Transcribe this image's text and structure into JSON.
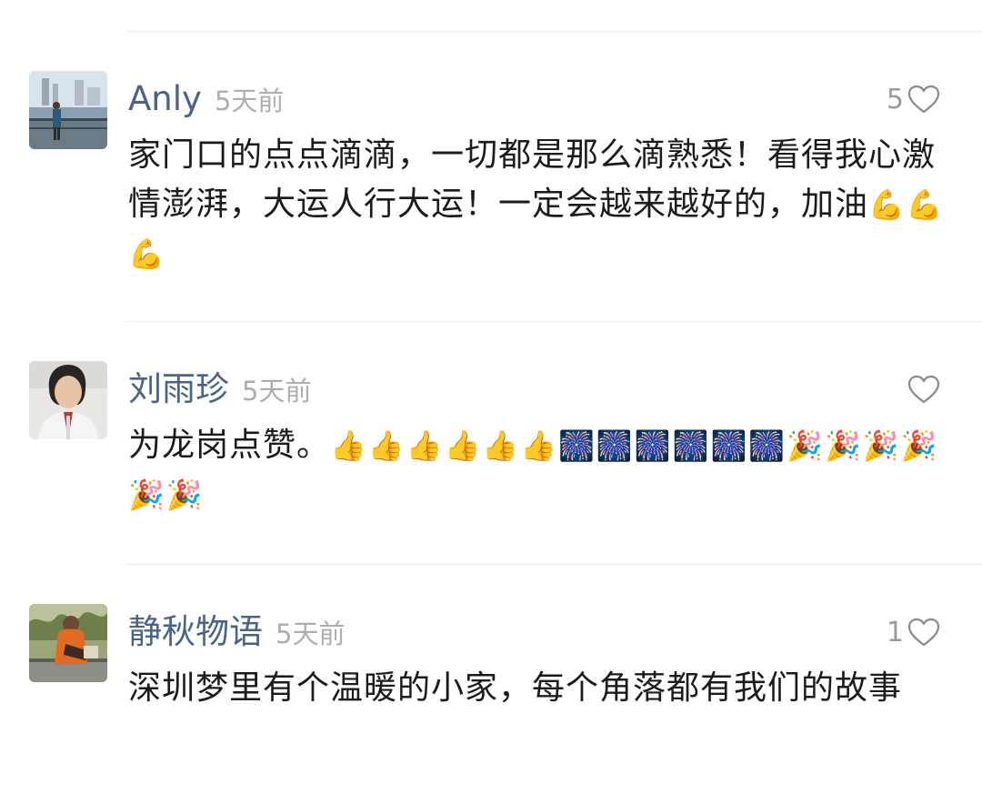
{
  "comments": [
    {
      "user": "Anly",
      "time": "5天前",
      "likes": "5",
      "text": "家门口的点点滴滴，一切都是那么滴熟悉！看得我心激情澎湃，大运人行大运！一定会越来越好的，加油",
      "emoji": "💪💪💪"
    },
    {
      "user": "刘雨珍",
      "time": "5天前",
      "likes": "",
      "text": "为龙岗点赞。",
      "emoji": "👍👍👍👍👍👍🎆🎆🎆🎆🎆🎆🎉🎉🎉🎉🎉🎉"
    },
    {
      "user": "静秋物语",
      "time": "5天前",
      "likes": "1",
      "text": "深圳梦里有个温暖的小家，每个角落都有我们的故事",
      "emoji": ""
    }
  ],
  "icons": {
    "like": "heart-outline-icon"
  },
  "colors": {
    "username": "#4a6489",
    "timestamp": "#aeaeae",
    "text": "#1b1b1b",
    "divider": "#ececec"
  }
}
